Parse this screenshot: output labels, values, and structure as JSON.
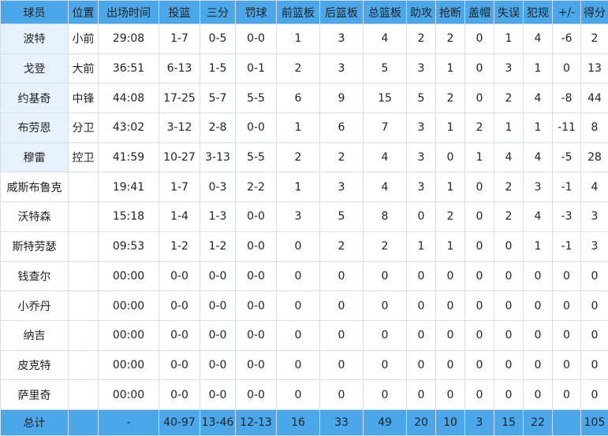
{
  "headers": [
    "球员",
    "位置",
    "出场时间",
    "投篮",
    "三分",
    "罚球",
    "前篮板",
    "后篮板",
    "总篮板",
    "助攻",
    "抢断",
    "盖帽",
    "失误",
    "犯规",
    "+/-",
    "得分"
  ],
  "players": [
    {
      "name": "波特",
      "pos": "小前",
      "min": "29:08",
      "fg": "1-7",
      "tp": "0-5",
      "ft": "0-0",
      "oreb": "1",
      "dreb": "3",
      "reb": "4",
      "ast": "2",
      "stl": "2",
      "blk": "0",
      "tov": "1",
      "pf": "4",
      "pm": "-6",
      "pts": "2",
      "starter": true
    },
    {
      "name": "戈登",
      "pos": "大前",
      "min": "36:51",
      "fg": "6-13",
      "tp": "1-5",
      "ft": "0-1",
      "oreb": "2",
      "dreb": "3",
      "reb": "5",
      "ast": "3",
      "stl": "1",
      "blk": "0",
      "tov": "3",
      "pf": "1",
      "pm": "0",
      "pts": "13",
      "starter": true
    },
    {
      "name": "约基奇",
      "pos": "中锋",
      "min": "44:08",
      "fg": "17-25",
      "tp": "5-7",
      "ft": "5-5",
      "oreb": "6",
      "dreb": "9",
      "reb": "15",
      "ast": "5",
      "stl": "2",
      "blk": "0",
      "tov": "2",
      "pf": "4",
      "pm": "-8",
      "pts": "44",
      "starter": true
    },
    {
      "name": "布劳恩",
      "pos": "分卫",
      "min": "43:02",
      "fg": "3-12",
      "tp": "2-8",
      "ft": "0-0",
      "oreb": "1",
      "dreb": "6",
      "reb": "7",
      "ast": "3",
      "stl": "1",
      "blk": "2",
      "tov": "1",
      "pf": "1",
      "pm": "-11",
      "pts": "8",
      "starter": true
    },
    {
      "name": "穆雷",
      "pos": "控卫",
      "min": "41:59",
      "fg": "10-27",
      "tp": "3-13",
      "ft": "5-5",
      "oreb": "2",
      "dreb": "2",
      "reb": "4",
      "ast": "3",
      "stl": "0",
      "blk": "1",
      "tov": "4",
      "pf": "4",
      "pm": "-5",
      "pts": "28",
      "starter": true
    },
    {
      "name": "威斯布鲁克",
      "pos": "",
      "min": "19:41",
      "fg": "1-7",
      "tp": "0-3",
      "ft": "2-2",
      "oreb": "1",
      "dreb": "3",
      "reb": "4",
      "ast": "3",
      "stl": "1",
      "blk": "0",
      "tov": "2",
      "pf": "3",
      "pm": "-1",
      "pts": "4",
      "starter": false
    },
    {
      "name": "沃特森",
      "pos": "",
      "min": "15:18",
      "fg": "1-4",
      "tp": "1-3",
      "ft": "0-0",
      "oreb": "3",
      "dreb": "5",
      "reb": "8",
      "ast": "0",
      "stl": "2",
      "blk": "0",
      "tov": "2",
      "pf": "4",
      "pm": "-3",
      "pts": "3",
      "starter": false
    },
    {
      "name": "斯特劳瑟",
      "pos": "",
      "min": "09:53",
      "fg": "1-2",
      "tp": "1-2",
      "ft": "0-0",
      "oreb": "0",
      "dreb": "2",
      "reb": "2",
      "ast": "1",
      "stl": "1",
      "blk": "0",
      "tov": "0",
      "pf": "1",
      "pm": "-1",
      "pts": "3",
      "starter": false
    },
    {
      "name": "钱查尔",
      "pos": "",
      "min": "00:00",
      "fg": "0-0",
      "tp": "0-0",
      "ft": "0-0",
      "oreb": "0",
      "dreb": "0",
      "reb": "0",
      "ast": "0",
      "stl": "0",
      "blk": "0",
      "tov": "0",
      "pf": "0",
      "pm": "0",
      "pts": "0",
      "starter": false
    },
    {
      "name": "小乔丹",
      "pos": "",
      "min": "00:00",
      "fg": "0-0",
      "tp": "0-0",
      "ft": "0-0",
      "oreb": "0",
      "dreb": "0",
      "reb": "0",
      "ast": "0",
      "stl": "0",
      "blk": "0",
      "tov": "0",
      "pf": "0",
      "pm": "0",
      "pts": "0",
      "starter": false
    },
    {
      "name": "纳吉",
      "pos": "",
      "min": "00:00",
      "fg": "0-0",
      "tp": "0-0",
      "ft": "0-0",
      "oreb": "0",
      "dreb": "0",
      "reb": "0",
      "ast": "0",
      "stl": "0",
      "blk": "0",
      "tov": "0",
      "pf": "0",
      "pm": "0",
      "pts": "0",
      "starter": false
    },
    {
      "name": "皮克特",
      "pos": "",
      "min": "00:00",
      "fg": "0-0",
      "tp": "0-0",
      "ft": "0-0",
      "oreb": "0",
      "dreb": "0",
      "reb": "0",
      "ast": "0",
      "stl": "0",
      "blk": "0",
      "tov": "0",
      "pf": "0",
      "pm": "0",
      "pts": "0",
      "starter": false
    },
    {
      "name": "萨里奇",
      "pos": "",
      "min": "00:00",
      "fg": "0-0",
      "tp": "0-0",
      "ft": "0-0",
      "oreb": "0",
      "dreb": "0",
      "reb": "0",
      "ast": "0",
      "stl": "0",
      "blk": "0",
      "tov": "0",
      "pf": "0",
      "pm": "0",
      "pts": "0",
      "starter": false
    }
  ],
  "totals": {
    "name": "总计",
    "pos": "",
    "min": "-",
    "fg": "40-97",
    "tp": "13-46",
    "ft": "12-13",
    "oreb": "16",
    "dreb": "33",
    "reb": "49",
    "ast": "20",
    "stl": "10",
    "blk": "3",
    "tov": "15",
    "pf": "22",
    "pm": "",
    "pts": "105"
  },
  "colors": {
    "header_bg": "#4aa8ea",
    "starter_name": "#e0191e",
    "starter_bg": "#e7f1fb",
    "border": "#d9dee6"
  }
}
